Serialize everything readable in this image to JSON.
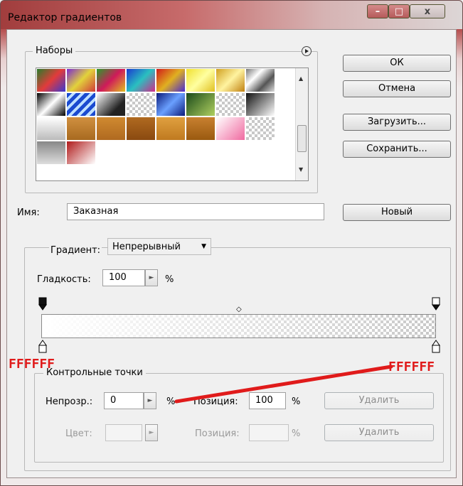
{
  "window": {
    "title": "Редактор градиентов",
    "controls": {
      "minimize": "–",
      "maximize": "□",
      "close": "x"
    }
  },
  "presets": {
    "group_label": "Наборы",
    "menu_icon": "circle-arrow-right-icon"
  },
  "buttons": {
    "ok": "ОК",
    "cancel": "Отмена",
    "load": "Загрузить...",
    "save": "Сохранить...",
    "new": "Новый"
  },
  "name": {
    "label": "Имя:",
    "value": "Заказная"
  },
  "gradient": {
    "type_label": "Градиент:",
    "type_value": "Непрерывный",
    "smoothness_label": "Гладкость:",
    "smoothness_value": "100",
    "smoothness_unit": "%"
  },
  "stops_group": {
    "label": "Контрольные точки",
    "opacity_label": "Непрозр.:",
    "opacity_value": "0",
    "opacity_unit": "%",
    "opacity_position_label": "Позиция:",
    "opacity_position_value": "100",
    "opacity_position_unit": "%",
    "opacity_delete": "Удалить",
    "color_label": "Цвет:",
    "color_position_label": "Позиция:",
    "color_position_unit": "%",
    "color_delete": "Удалить"
  },
  "annotations": {
    "left": "FFFFFF",
    "right": "FFFFFF",
    "color": "#e01b1b"
  }
}
